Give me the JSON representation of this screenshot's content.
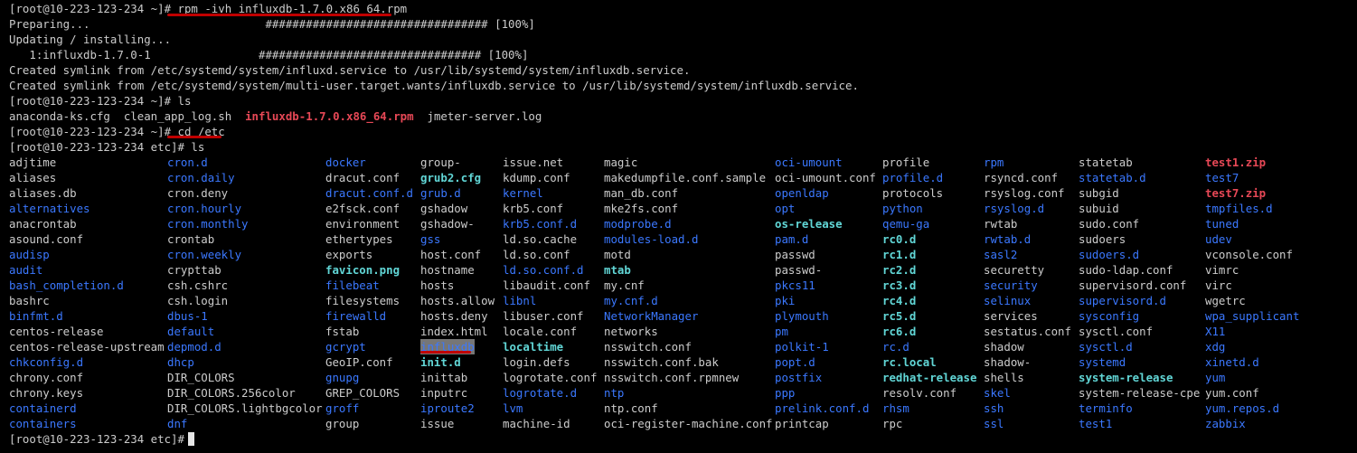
{
  "colors": {
    "background": "#000000",
    "text": "#cccccc",
    "dir": "#3b78ff",
    "link": "#61d6d6",
    "exec": "#16c60c",
    "archive": "#e74856",
    "underline": "#c00000"
  },
  "terminal": {
    "lines": [
      {
        "segments": [
          {
            "t": "[root@10-223-123-234 ~]# "
          },
          {
            "t": "rpm -ivh influxdb-1.7.0.x86_64.rpm"
          }
        ]
      },
      {
        "segments": [
          {
            "t": "Preparing...                          ################################# [100%]"
          }
        ]
      },
      {
        "segments": [
          {
            "t": "Updating / installing..."
          }
        ]
      },
      {
        "segments": [
          {
            "t": "   1:influxdb-1.7.0-1                ################################# [100%]"
          }
        ]
      },
      {
        "segments": [
          {
            "t": "Created symlink from /etc/systemd/system/influxd.service to /usr/lib/systemd/system/influxdb.service."
          }
        ]
      },
      {
        "segments": [
          {
            "t": "Created symlink from /etc/systemd/system/multi-user.target.wants/influxdb.service to /usr/lib/systemd/system/influxdb.service."
          }
        ]
      },
      {
        "segments": [
          {
            "t": "[root@10-223-123-234 ~]# ls"
          }
        ]
      },
      {
        "segments": [
          {
            "t": "anaconda-ks.cfg  clean_app_log.sh  "
          },
          {
            "t": "influxdb-1.7.0.x86_64.rpm",
            "c": "archive"
          },
          {
            "t": "  jmeter-server.log"
          }
        ]
      },
      {
        "segments": [
          {
            "t": "[root@10-223-123-234 ~]# "
          },
          {
            "t": "cd /etc"
          }
        ]
      },
      {
        "segments": [
          {
            "t": "[root@10-223-123-234 etc]# ls"
          }
        ]
      }
    ],
    "columns": [
      [
        [
          "adjtime",
          ""
        ],
        [
          "aliases",
          ""
        ],
        [
          "aliases.db",
          ""
        ],
        [
          "alternatives",
          "dir"
        ],
        [
          "anacrontab",
          ""
        ],
        [
          "asound.conf",
          ""
        ],
        [
          "audisp",
          "dir"
        ],
        [
          "audit",
          "dir"
        ],
        [
          "bash_completion.d",
          "dir"
        ],
        [
          "bashrc",
          ""
        ],
        [
          "binfmt.d",
          "dir"
        ],
        [
          "centos-release",
          ""
        ],
        [
          "centos-release-upstream",
          ""
        ],
        [
          "chkconfig.d",
          "dir"
        ],
        [
          "chrony.conf",
          ""
        ],
        [
          "chrony.keys",
          ""
        ],
        [
          "containerd",
          "dir"
        ],
        [
          "containers",
          "dir"
        ]
      ],
      [
        [
          "cron.d",
          "dir"
        ],
        [
          "cron.daily",
          "dir"
        ],
        [
          "cron.deny",
          ""
        ],
        [
          "cron.hourly",
          "dir"
        ],
        [
          "cron.monthly",
          "dir"
        ],
        [
          "crontab",
          ""
        ],
        [
          "cron.weekly",
          "dir"
        ],
        [
          "crypttab",
          ""
        ],
        [
          "csh.cshrc",
          ""
        ],
        [
          "csh.login",
          ""
        ],
        [
          "dbus-1",
          "dir"
        ],
        [
          "default",
          "dir"
        ],
        [
          "depmod.d",
          "dir"
        ],
        [
          "dhcp",
          "dir"
        ],
        [
          "DIR_COLORS",
          ""
        ],
        [
          "DIR_COLORS.256color",
          ""
        ],
        [
          "DIR_COLORS.lightbgcolor",
          ""
        ],
        [
          "dnf",
          "dir"
        ]
      ],
      [
        [
          "docker",
          "dir"
        ],
        [
          "dracut.conf",
          ""
        ],
        [
          "dracut.conf.d",
          "dir"
        ],
        [
          "e2fsck.conf",
          ""
        ],
        [
          "environment",
          ""
        ],
        [
          "ethertypes",
          ""
        ],
        [
          "exports",
          ""
        ],
        [
          "favicon.png",
          "link"
        ],
        [
          "filebeat",
          "dir"
        ],
        [
          "filesystems",
          ""
        ],
        [
          "firewalld",
          "dir"
        ],
        [
          "fstab",
          ""
        ],
        [
          "gcrypt",
          "dir"
        ],
        [
          "GeoIP.conf",
          ""
        ],
        [
          "gnupg",
          "dir"
        ],
        [
          "GREP_COLORS",
          ""
        ],
        [
          "groff",
          "dir"
        ],
        [
          "group",
          ""
        ]
      ],
      [
        [
          "group-",
          ""
        ],
        [
          "grub2.cfg",
          "link"
        ],
        [
          "grub.d",
          "dir"
        ],
        [
          "gshadow",
          ""
        ],
        [
          "gshadow-",
          ""
        ],
        [
          "gss",
          "dir"
        ],
        [
          "host.conf",
          ""
        ],
        [
          "hostname",
          ""
        ],
        [
          "hosts",
          ""
        ],
        [
          "hosts.allow",
          ""
        ],
        [
          "hosts.deny",
          ""
        ],
        [
          "index.html",
          ""
        ],
        [
          "influxdb",
          "hl"
        ],
        [
          "init.d",
          "link"
        ],
        [
          "inittab",
          ""
        ],
        [
          "inputrc",
          ""
        ],
        [
          "iproute2",
          "dir"
        ],
        [
          "issue",
          ""
        ]
      ],
      [
        [
          "issue.net",
          ""
        ],
        [
          "kdump.conf",
          ""
        ],
        [
          "kernel",
          "dir"
        ],
        [
          "krb5.conf",
          ""
        ],
        [
          "krb5.conf.d",
          "dir"
        ],
        [
          "ld.so.cache",
          ""
        ],
        [
          "ld.so.conf",
          ""
        ],
        [
          "ld.so.conf.d",
          "dir"
        ],
        [
          "libaudit.conf",
          ""
        ],
        [
          "libnl",
          "dir"
        ],
        [
          "libuser.conf",
          ""
        ],
        [
          "locale.conf",
          ""
        ],
        [
          "localtime",
          "link"
        ],
        [
          "login.defs",
          ""
        ],
        [
          "logrotate.conf",
          ""
        ],
        [
          "logrotate.d",
          "dir"
        ],
        [
          "lvm",
          "dir"
        ],
        [
          "machine-id",
          ""
        ]
      ],
      [
        [
          "magic",
          ""
        ],
        [
          "makedumpfile.conf.sample",
          ""
        ],
        [
          "man_db.conf",
          ""
        ],
        [
          "mke2fs.conf",
          ""
        ],
        [
          "modprobe.d",
          "dir"
        ],
        [
          "modules-load.d",
          "dir"
        ],
        [
          "motd",
          ""
        ],
        [
          "mtab",
          "link"
        ],
        [
          "my.cnf",
          ""
        ],
        [
          "my.cnf.d",
          "dir"
        ],
        [
          "NetworkManager",
          "dir"
        ],
        [
          "networks",
          ""
        ],
        [
          "nsswitch.conf",
          ""
        ],
        [
          "nsswitch.conf.bak",
          ""
        ],
        [
          "nsswitch.conf.rpmnew",
          ""
        ],
        [
          "ntp",
          "dir"
        ],
        [
          "ntp.conf",
          ""
        ],
        [
          "oci-register-machine.conf",
          ""
        ]
      ],
      [
        [
          "oci-umount",
          "dir"
        ],
        [
          "oci-umount.conf",
          ""
        ],
        [
          "openldap",
          "dir"
        ],
        [
          "opt",
          "dir"
        ],
        [
          "os-release",
          "link"
        ],
        [
          "pam.d",
          "dir"
        ],
        [
          "passwd",
          ""
        ],
        [
          "passwd-",
          ""
        ],
        [
          "pkcs11",
          "dir"
        ],
        [
          "pki",
          "dir"
        ],
        [
          "plymouth",
          "dir"
        ],
        [
          "pm",
          "dir"
        ],
        [
          "polkit-1",
          "dir"
        ],
        [
          "popt.d",
          "dir"
        ],
        [
          "postfix",
          "dir"
        ],
        [
          "ppp",
          "dir"
        ],
        [
          "prelink.conf.d",
          "dir"
        ],
        [
          "printcap",
          ""
        ]
      ],
      [
        [
          "profile",
          ""
        ],
        [
          "profile.d",
          "dir"
        ],
        [
          "protocols",
          ""
        ],
        [
          "python",
          "dir"
        ],
        [
          "qemu-ga",
          "dir"
        ],
        [
          "rc0.d",
          "link"
        ],
        [
          "rc1.d",
          "link"
        ],
        [
          "rc2.d",
          "link"
        ],
        [
          "rc3.d",
          "link"
        ],
        [
          "rc4.d",
          "link"
        ],
        [
          "rc5.d",
          "link"
        ],
        [
          "rc6.d",
          "link"
        ],
        [
          "rc.d",
          "dir"
        ],
        [
          "rc.local",
          "link"
        ],
        [
          "redhat-release",
          "link"
        ],
        [
          "resolv.conf",
          ""
        ],
        [
          "rhsm",
          "dir"
        ],
        [
          "rpc",
          ""
        ]
      ],
      [
        [
          "rpm",
          "dir"
        ],
        [
          "rsyncd.conf",
          ""
        ],
        [
          "rsyslog.conf",
          ""
        ],
        [
          "rsyslog.d",
          "dir"
        ],
        [
          "rwtab",
          ""
        ],
        [
          "rwtab.d",
          "dir"
        ],
        [
          "sasl2",
          "dir"
        ],
        [
          "securetty",
          ""
        ],
        [
          "security",
          "dir"
        ],
        [
          "selinux",
          "dir"
        ],
        [
          "services",
          ""
        ],
        [
          "sestatus.conf",
          ""
        ],
        [
          "shadow",
          ""
        ],
        [
          "shadow-",
          ""
        ],
        [
          "shells",
          ""
        ],
        [
          "skel",
          "dir"
        ],
        [
          "ssh",
          "dir"
        ],
        [
          "ssl",
          "dir"
        ]
      ],
      [
        [
          "statetab",
          ""
        ],
        [
          "statetab.d",
          "dir"
        ],
        [
          "subgid",
          ""
        ],
        [
          "subuid",
          ""
        ],
        [
          "sudo.conf",
          ""
        ],
        [
          "sudoers",
          ""
        ],
        [
          "sudoers.d",
          "dir"
        ],
        [
          "sudo-ldap.conf",
          ""
        ],
        [
          "supervisord.conf",
          ""
        ],
        [
          "supervisord.d",
          "dir"
        ],
        [
          "sysconfig",
          "dir"
        ],
        [
          "sysctl.conf",
          ""
        ],
        [
          "sysctl.d",
          "dir"
        ],
        [
          "systemd",
          "dir"
        ],
        [
          "system-release",
          "link"
        ],
        [
          "system-release-cpe",
          ""
        ],
        [
          "terminfo",
          "dir"
        ],
        [
          "test1",
          "dir"
        ]
      ],
      [
        [
          "test1.zip",
          "archive"
        ],
        [
          "test7",
          "dir"
        ],
        [
          "test7.zip",
          "archive"
        ],
        [
          "tmpfiles.d",
          "dir"
        ],
        [
          "tuned",
          "dir"
        ],
        [
          "udev",
          "dir"
        ],
        [
          "vconsole.conf",
          ""
        ],
        [
          "vimrc",
          ""
        ],
        [
          "virc",
          ""
        ],
        [
          "wgetrc",
          ""
        ],
        [
          "wpa_supplicant",
          "dir"
        ],
        [
          "X11",
          "dir"
        ],
        [
          "xdg",
          "dir"
        ],
        [
          "xinetd.d",
          "dir"
        ],
        [
          "yum",
          "dir"
        ],
        [
          "yum.conf",
          ""
        ],
        [
          "yum.repos.d",
          "dir"
        ],
        [
          "zabbix",
          "dir"
        ]
      ]
    ],
    "final_prompt": "[root@10-223-123-234 etc]#"
  }
}
